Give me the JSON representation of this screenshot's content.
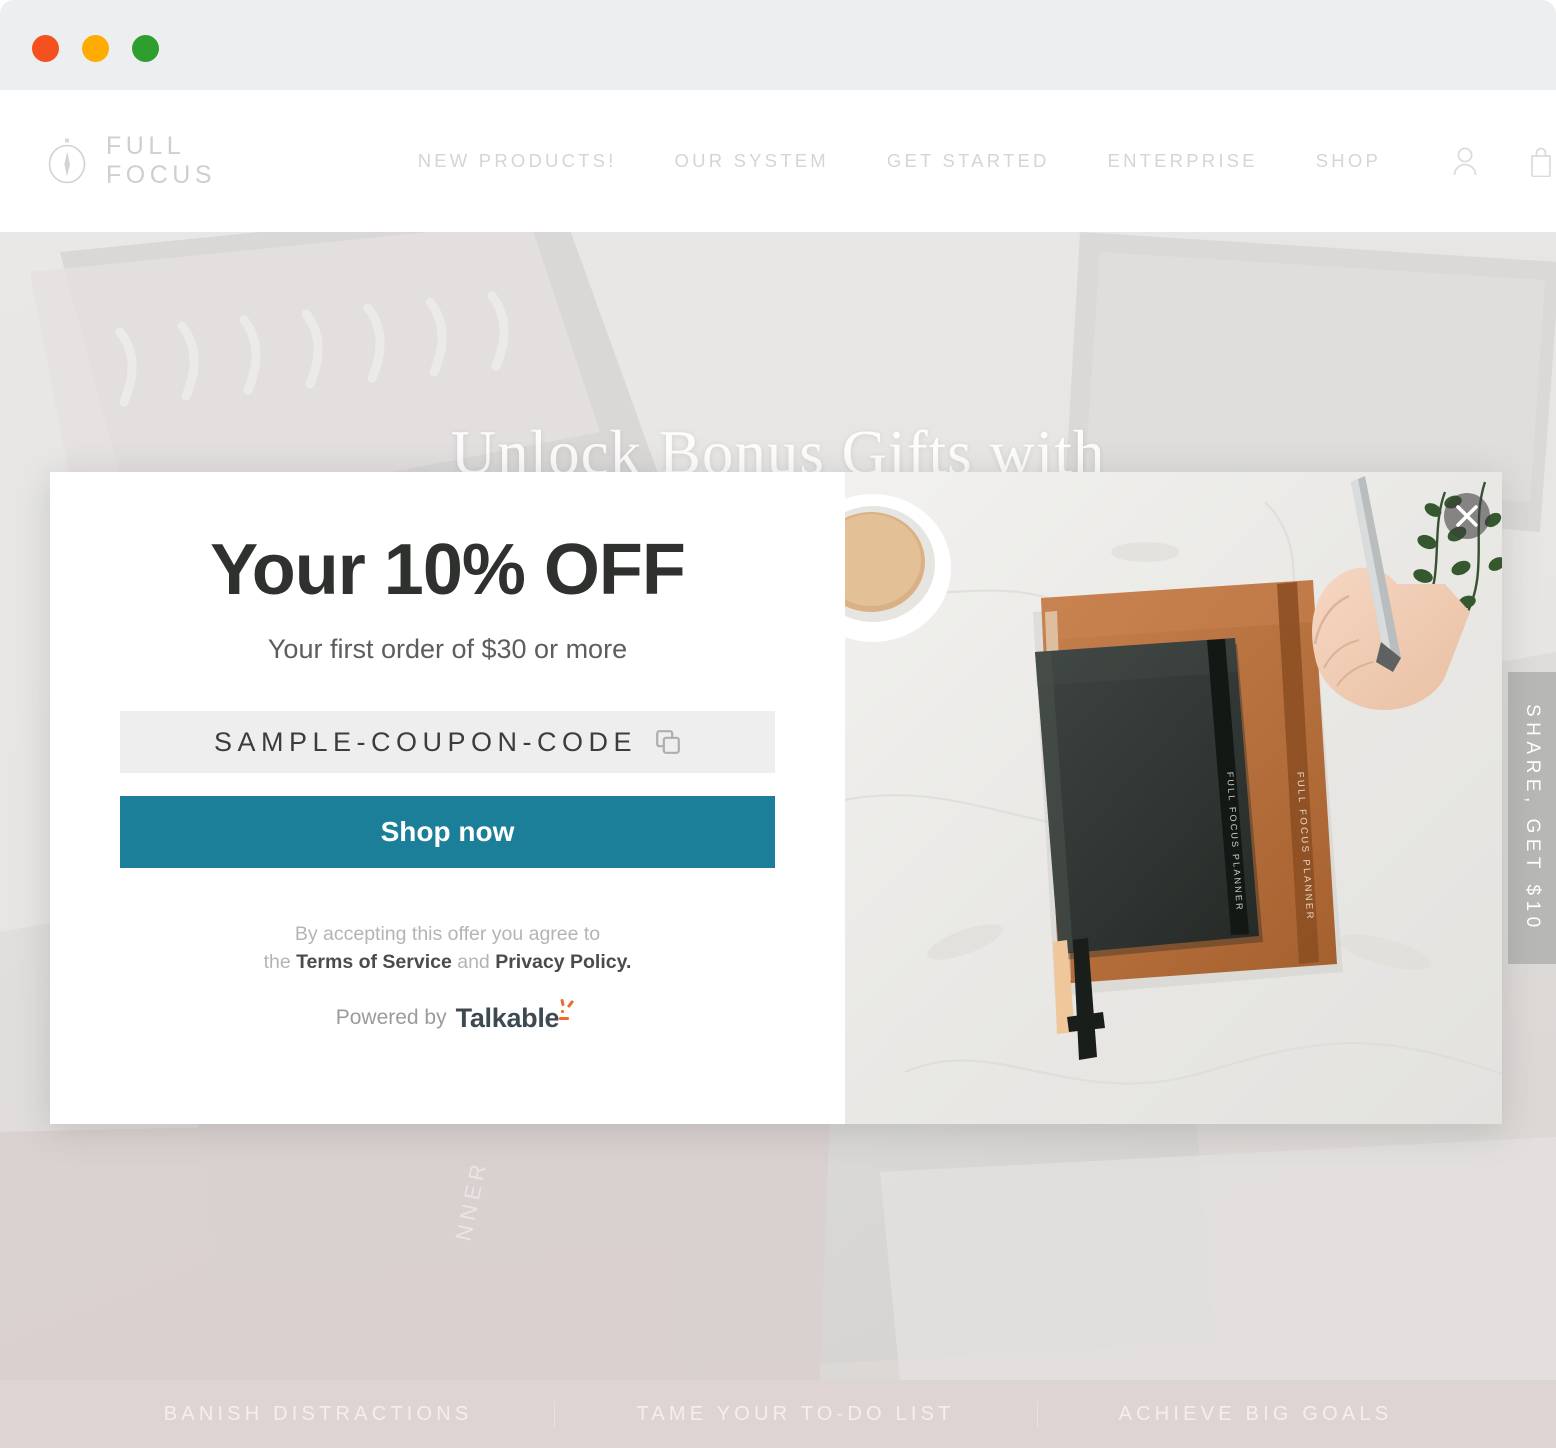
{
  "window": {
    "traffic_lights": [
      {
        "name": "close",
        "color": "#f4511e"
      },
      {
        "name": "minimize",
        "color": "#ffab00"
      },
      {
        "name": "zoom",
        "color": "#2e9e2e"
      }
    ]
  },
  "nav": {
    "brand": "FULL FOCUS",
    "brand_icon": "compass-icon",
    "links": [
      "NEW PRODUCTS!",
      "OUR SYSTEM",
      "GET STARTED",
      "ENTERPRISE",
      "SHOP"
    ],
    "icons": [
      "account-icon",
      "bag-icon"
    ]
  },
  "hero": {
    "title": "Unlock Bonus Gifts with"
  },
  "share_tab": {
    "label": "SHARE, GET $10"
  },
  "bottom_band": {
    "items": [
      "BANISH DISTRACTIONS",
      "TAME YOUR TO-DO LIST",
      "ACHIEVE BIG GOALS"
    ]
  },
  "modal": {
    "title": "Your 10% OFF",
    "subtitle": "Your first order of $30 or more",
    "coupon_code": "SAMPLE-COUPON-CODE",
    "copy_icon": "copy-icon",
    "cta_label": "Shop now",
    "legal_line1": "By accepting this offer you agree to",
    "legal_prefix": "the ",
    "legal_terms": "Terms of Service",
    "legal_and": " and ",
    "legal_privacy": "Privacy Policy.",
    "powered_by": "Powered by",
    "powered_brand": "Talkable",
    "close_icon": "close-icon",
    "accent_color": "#1c7f99",
    "image_alt": "flat-lay of Full Focus planners with coffee and pen"
  }
}
